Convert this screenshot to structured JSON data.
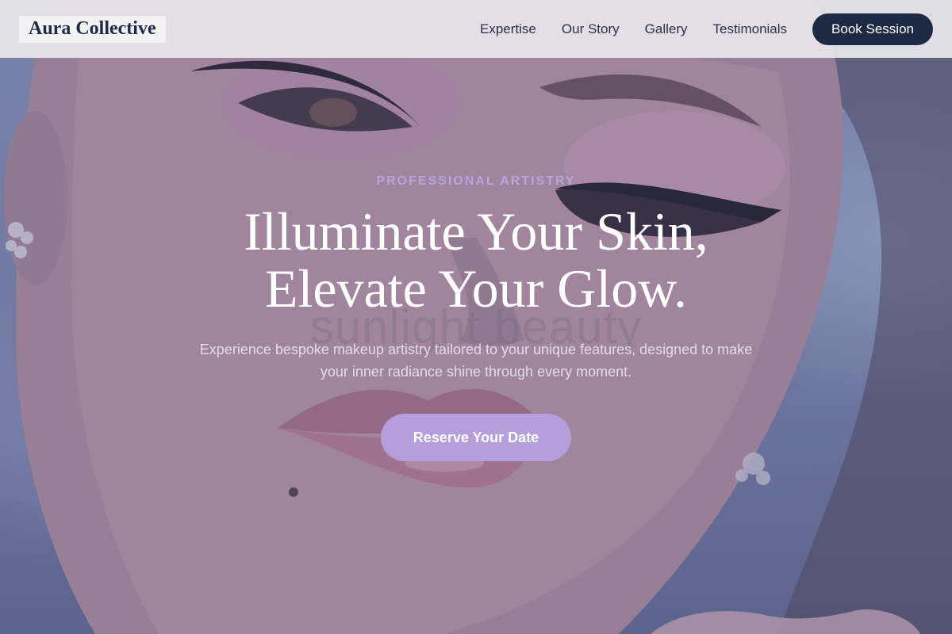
{
  "nav": {
    "brand": "Aura Collective",
    "links": [
      {
        "label": "Expertise"
      },
      {
        "label": "Our Story"
      },
      {
        "label": "Gallery"
      },
      {
        "label": "Testimonials"
      }
    ],
    "cta_label": "Book Session"
  },
  "hero": {
    "eyebrow": "PROFESSIONAL ARTISTRY",
    "headline_line1": "Illuminate Your Skin,",
    "headline_line2": "Elevate Your Glow.",
    "background_text": "sunlight beauty",
    "subtitle": "Experience bespoke makeup artistry tailored to your unique features, designed to make your inner radiance shine through every moment.",
    "cta_label": "Reserve Your Date",
    "background_image": "makeup-portrait"
  },
  "colors": {
    "navy": "#1e2a44",
    "lavender": "#b49fdc",
    "eyebrow_purple": "#b9a3e0",
    "nav_background": "#eceaf0"
  }
}
